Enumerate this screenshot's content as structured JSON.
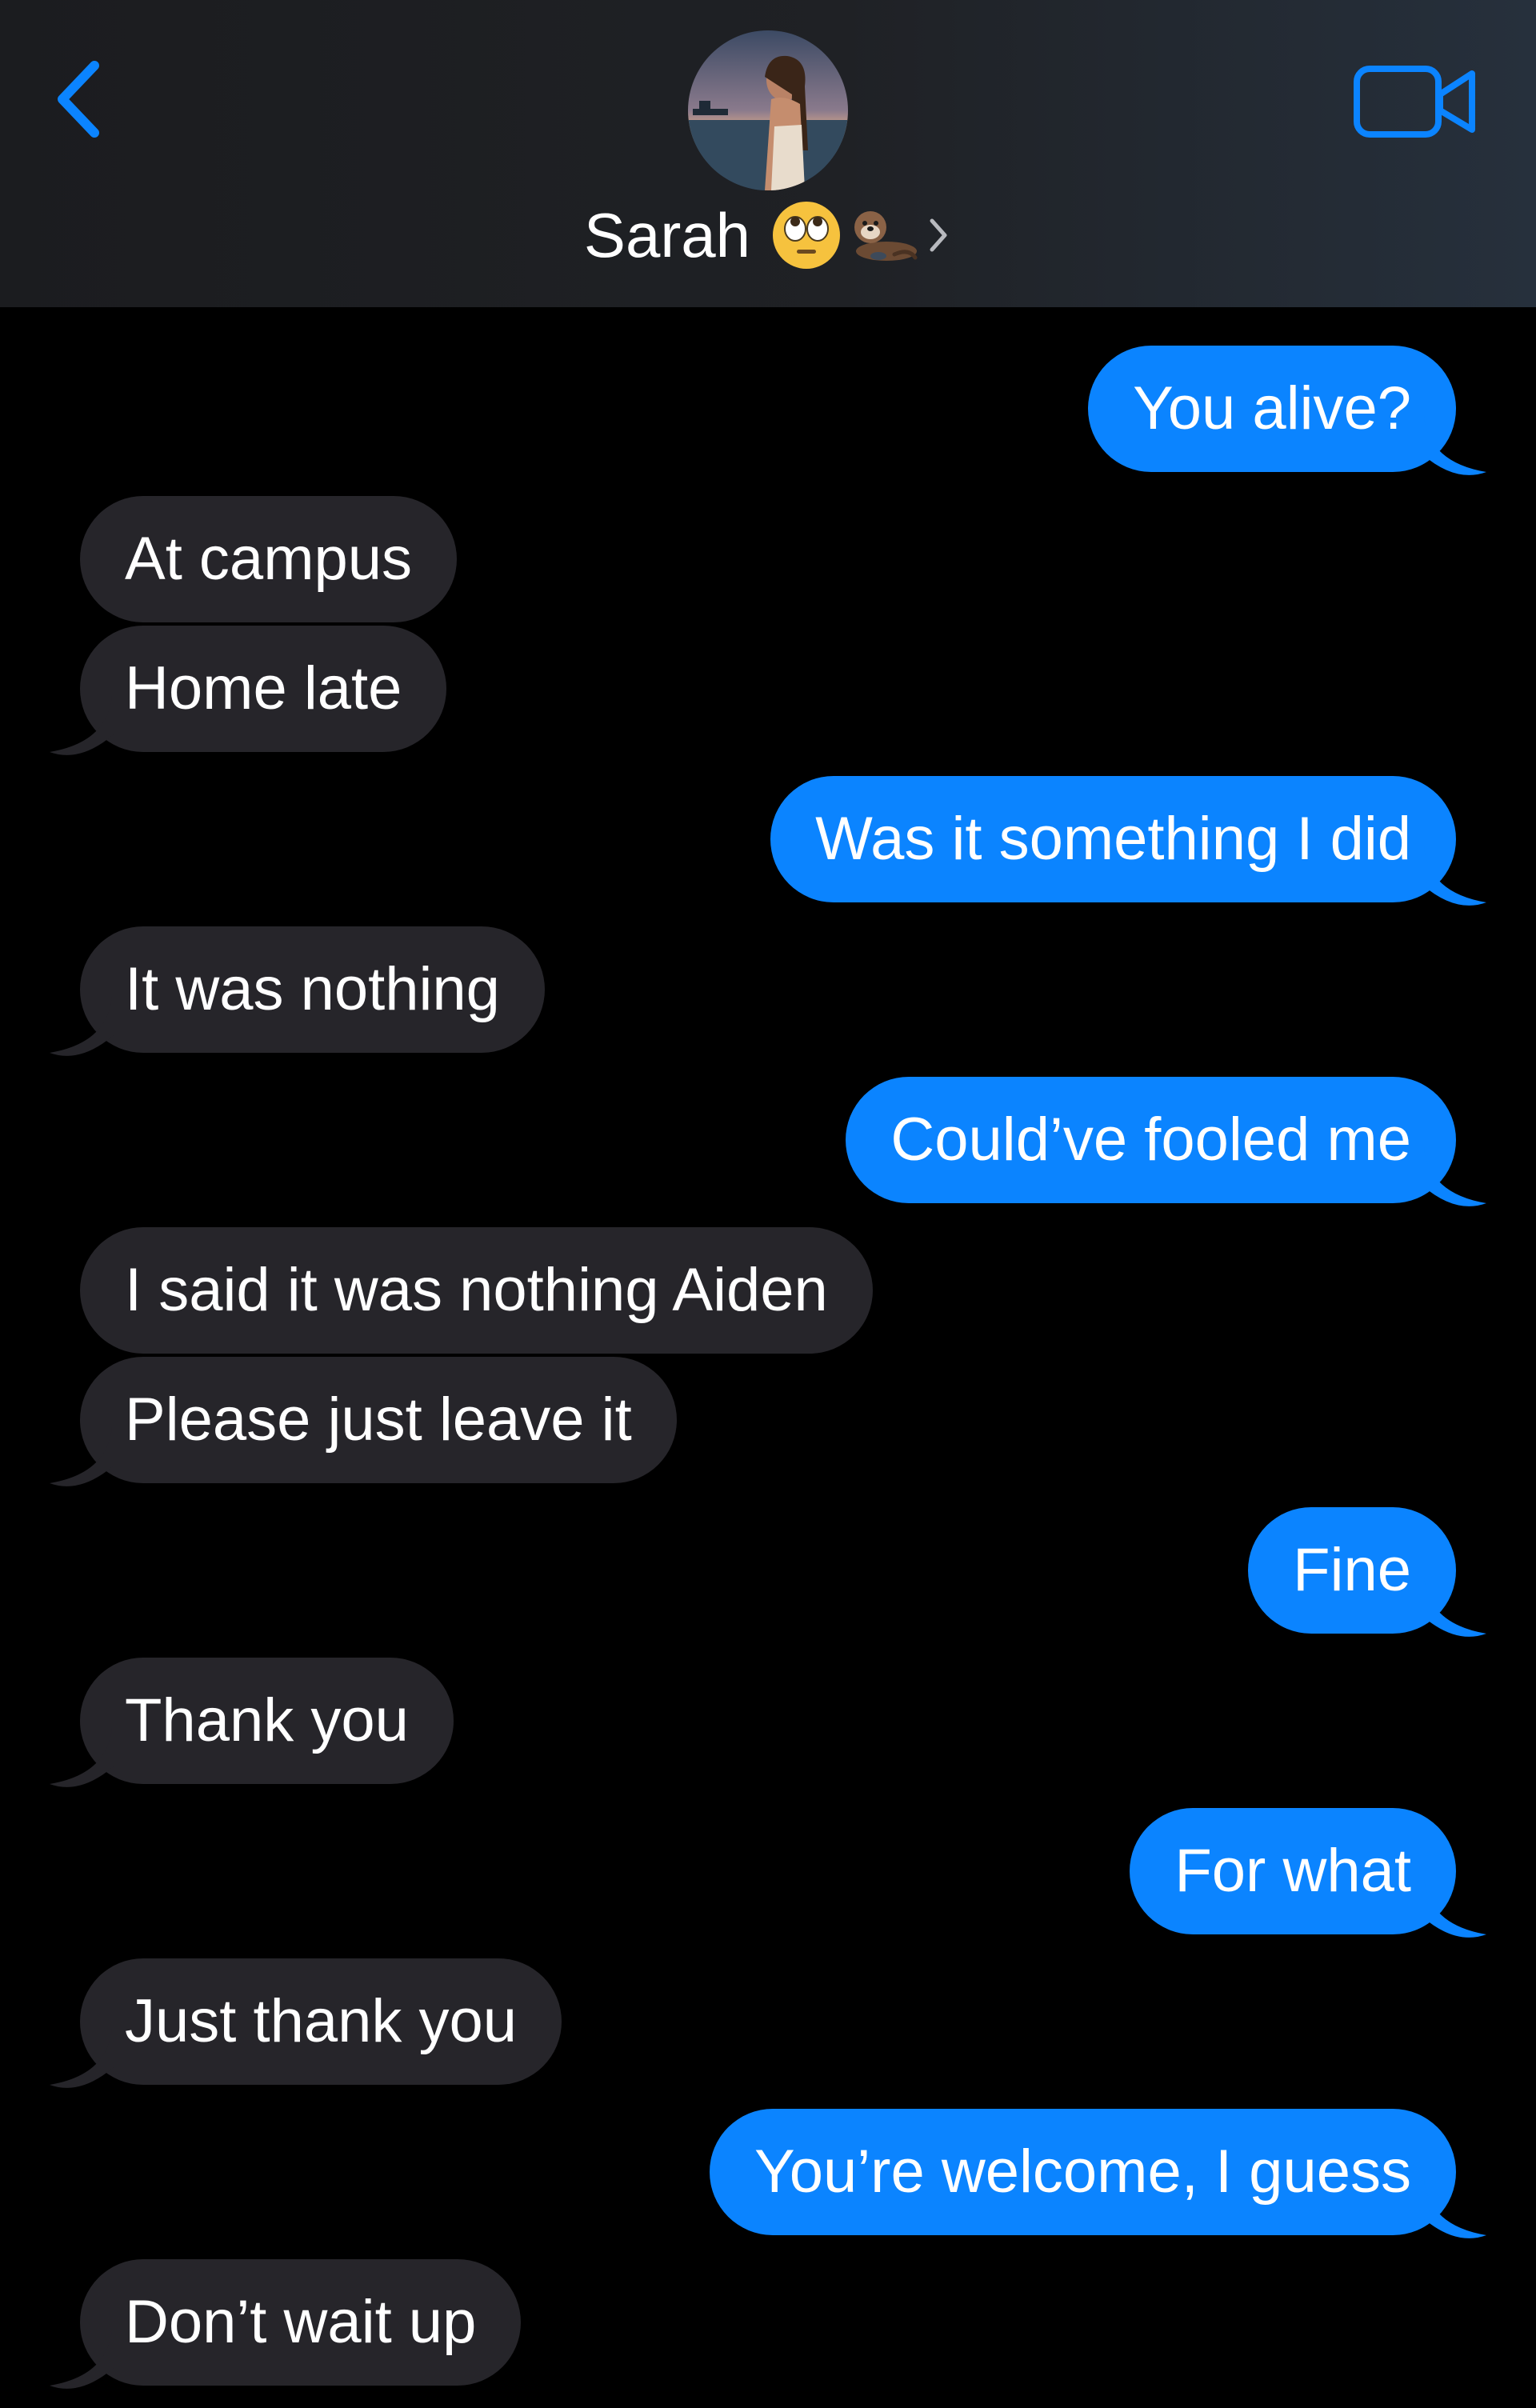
{
  "header": {
    "contact_name": "Sarah",
    "contact_emoji_icons": [
      "face-with-rolling-eyes-icon",
      "otter-icon"
    ],
    "back_icon": "chevron-left-icon",
    "video_icon": "video-camera-icon",
    "accent_color": "#0b84ff"
  },
  "colors": {
    "outgoing_bubble": "#0b84ff",
    "incoming_bubble": "#26252a",
    "background": "#000000",
    "text": "#ffffff"
  },
  "messages": [
    {
      "sender": "me",
      "text": "You alive?"
    },
    {
      "sender": "them",
      "text": "At campus"
    },
    {
      "sender": "them",
      "text": "Home late"
    },
    {
      "sender": "me",
      "text": "Was it something I did"
    },
    {
      "sender": "them",
      "text": "It was nothing"
    },
    {
      "sender": "me",
      "text": "Could’ve fooled me"
    },
    {
      "sender": "them",
      "text": "I said it was nothing Aiden"
    },
    {
      "sender": "them",
      "text": "Please just leave it"
    },
    {
      "sender": "me",
      "text": "Fine"
    },
    {
      "sender": "them",
      "text": "Thank you"
    },
    {
      "sender": "me",
      "text": "For what"
    },
    {
      "sender": "them",
      "text": "Just thank you"
    },
    {
      "sender": "me",
      "text": "You’re welcome, I guess"
    },
    {
      "sender": "them",
      "text": "Don’t wait up"
    }
  ]
}
